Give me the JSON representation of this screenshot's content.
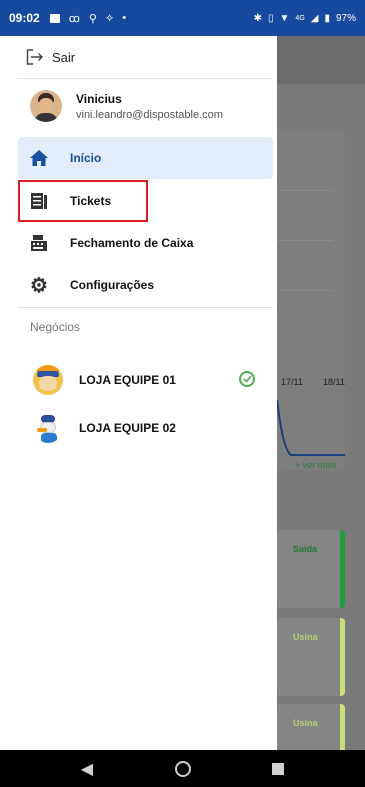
{
  "status_bar": {
    "time": "09:02",
    "battery": "97%",
    "network": "4G"
  },
  "drawer": {
    "logout_label": "Sair",
    "user": {
      "name": "Vinicius",
      "email": "vini.leandro@dispostable.com"
    },
    "nav_items": [
      {
        "label": "Início",
        "icon": "home-icon",
        "active": true
      },
      {
        "label": "Tickets",
        "icon": "ticket-icon",
        "active": false
      },
      {
        "label": "Fechamento de Caixa",
        "icon": "cash-register-icon",
        "active": false
      },
      {
        "label": "Configurações",
        "icon": "gear-icon",
        "active": false
      }
    ],
    "section_title": "Negócios",
    "businesses": [
      {
        "name": "LOJA EQUIPE 01",
        "selected": true
      },
      {
        "name": "LOJA EQUIPE 02",
        "selected": false
      }
    ]
  },
  "background": {
    "x_labels": [
      "17/11",
      "18/11"
    ],
    "see_more": "+ ver mais",
    "cards": [
      {
        "label": "Saída",
        "color": "#1e9e3a"
      },
      {
        "label": "Usina",
        "color": "#c7e07a"
      },
      {
        "label": "Usina",
        "color": "#c7e07a"
      }
    ]
  },
  "colors": {
    "primary": "#174a9e",
    "active_bg": "#e3ecfb",
    "highlight": "#e01c1c",
    "success": "#4caf50"
  }
}
